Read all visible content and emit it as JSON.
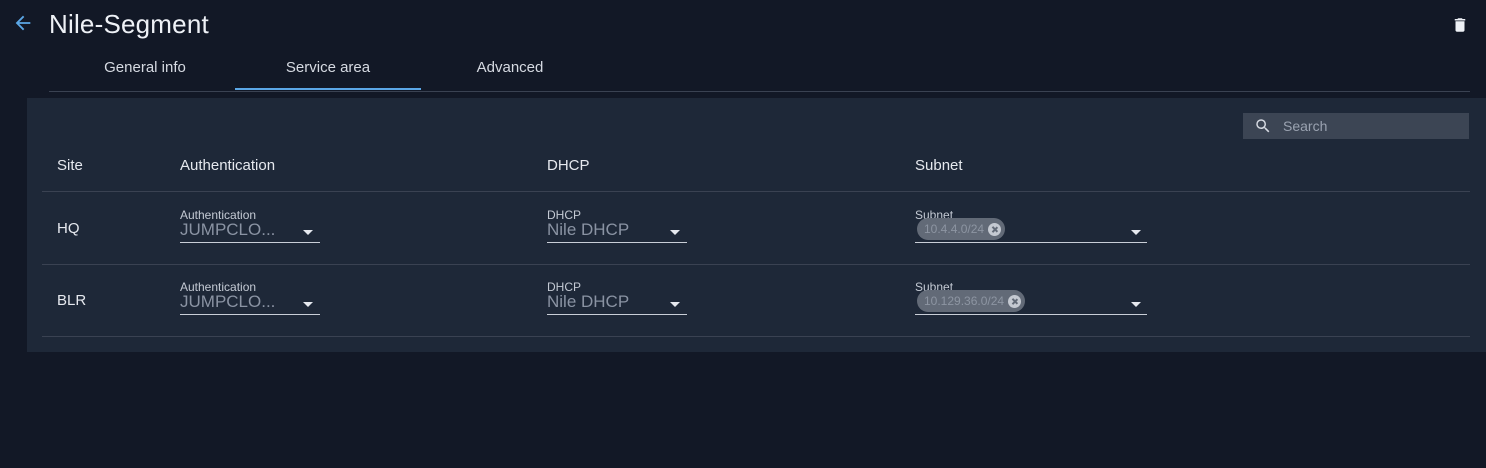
{
  "header": {
    "title": "Nile-Segment"
  },
  "tabs": [
    {
      "label": "General info",
      "active": false
    },
    {
      "label": "Service area",
      "active": true
    },
    {
      "label": "Advanced",
      "active": false
    }
  ],
  "search": {
    "placeholder": "Search"
  },
  "table": {
    "columns": [
      "Site",
      "Authentication",
      "DHCP",
      "Subnet"
    ],
    "rows": [
      {
        "site": "HQ",
        "authentication": {
          "label": "Authentication",
          "value": "JUMPCLO..."
        },
        "dhcp": {
          "label": "DHCP",
          "value": "Nile DHCP"
        },
        "subnet": {
          "label": "Subnet",
          "chip": "10.4.4.0/24"
        }
      },
      {
        "site": "BLR",
        "authentication": {
          "label": "Authentication",
          "value": "JUMPCLO..."
        },
        "dhcp": {
          "label": "DHCP",
          "value": "Nile DHCP"
        },
        "subnet": {
          "label": "Subnet",
          "chip": "10.129.36.0/24"
        }
      }
    ]
  },
  "icons": {
    "back": "arrow-left-icon",
    "delete": "trash-icon",
    "search": "search-icon",
    "dropdown": "caret-down-icon",
    "chip_remove": "close-circle-icon"
  },
  "colors": {
    "background": "#121826",
    "panel": "#1e2838",
    "accent": "#5ba7e6",
    "search_bg": "#3c4554"
  }
}
